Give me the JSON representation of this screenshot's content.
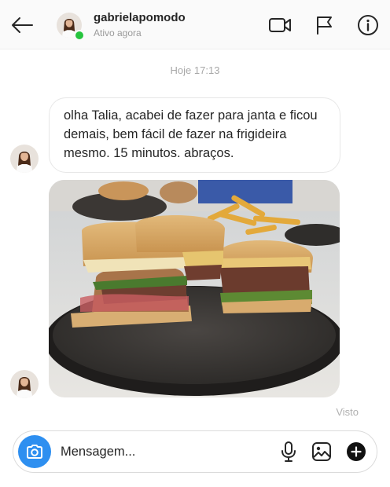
{
  "header": {
    "username": "gabrielapomodo",
    "status": "Ativo agora",
    "icons": [
      "back-arrow-icon",
      "video-call-icon",
      "flag-icon",
      "info-icon"
    ]
  },
  "thread": {
    "timestamp": "Hoje 17:13",
    "messages": [
      {
        "type": "text",
        "text": "olha Talia, acabei de fazer para janta e ficou demais, bem fácil de fazer na frigideira mesmo. 15 minutos. abraços."
      },
      {
        "type": "photo",
        "content": "burger-photo"
      }
    ],
    "seen_label": "Visto"
  },
  "composer": {
    "placeholder": "Mensagem...",
    "icons": [
      "camera-icon",
      "microphone-icon",
      "gallery-icon",
      "plus-icon"
    ]
  },
  "colors": {
    "accent": "#2e8ff0",
    "online": "#26c43e",
    "muted_text": "#a8a8a8"
  }
}
